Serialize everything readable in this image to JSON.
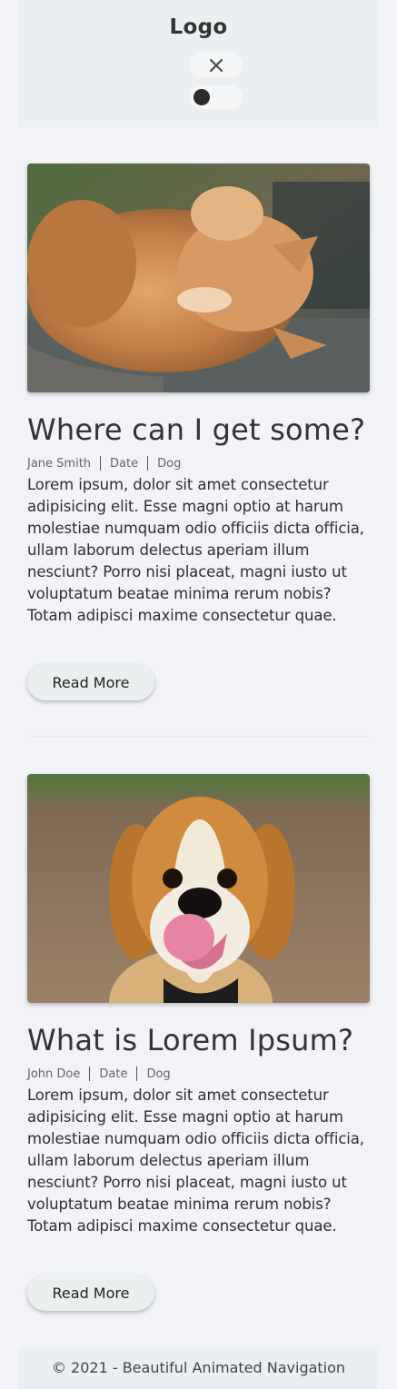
{
  "header": {
    "logo": "Logo",
    "close_icon": "close-icon",
    "toggle_state": "off"
  },
  "posts": [
    {
      "image": "cat-photo",
      "title": "Where can I get some?",
      "author": "Jane Smith",
      "date": "Date",
      "category": "Dog",
      "excerpt": "Lorem ipsum, dolor sit amet consectetur adipisicing elit. Esse magni optio at harum molestiae numquam odio officiis dicta officia, ullam laborum delectus aperiam illum nesciunt? Porro nisi placeat, magni iusto ut voluptatum beatae minima rerum nobis? Totam adipisci maxime consectetur quae.",
      "button": "Read More"
    },
    {
      "image": "dog-photo",
      "title": "What is Lorem Ipsum?",
      "author": "John Doe",
      "date": "Date",
      "category": "Dog",
      "excerpt": "Lorem ipsum, dolor sit amet consectetur adipisicing elit. Esse magni optio at harum molestiae numquam odio officiis dicta officia, ullam laborum delectus aperiam illum nesciunt? Porro nisi placeat, magni iusto ut voluptatum beatae minima rerum nobis? Totam adipisci maxime consectetur quae.",
      "button": "Read More"
    }
  ],
  "footer": {
    "text": "© 2021 - Beautiful Animated Navigation"
  },
  "colors": {
    "background": "#f1f3f7",
    "header": "#eceff1",
    "text": "#333333"
  }
}
